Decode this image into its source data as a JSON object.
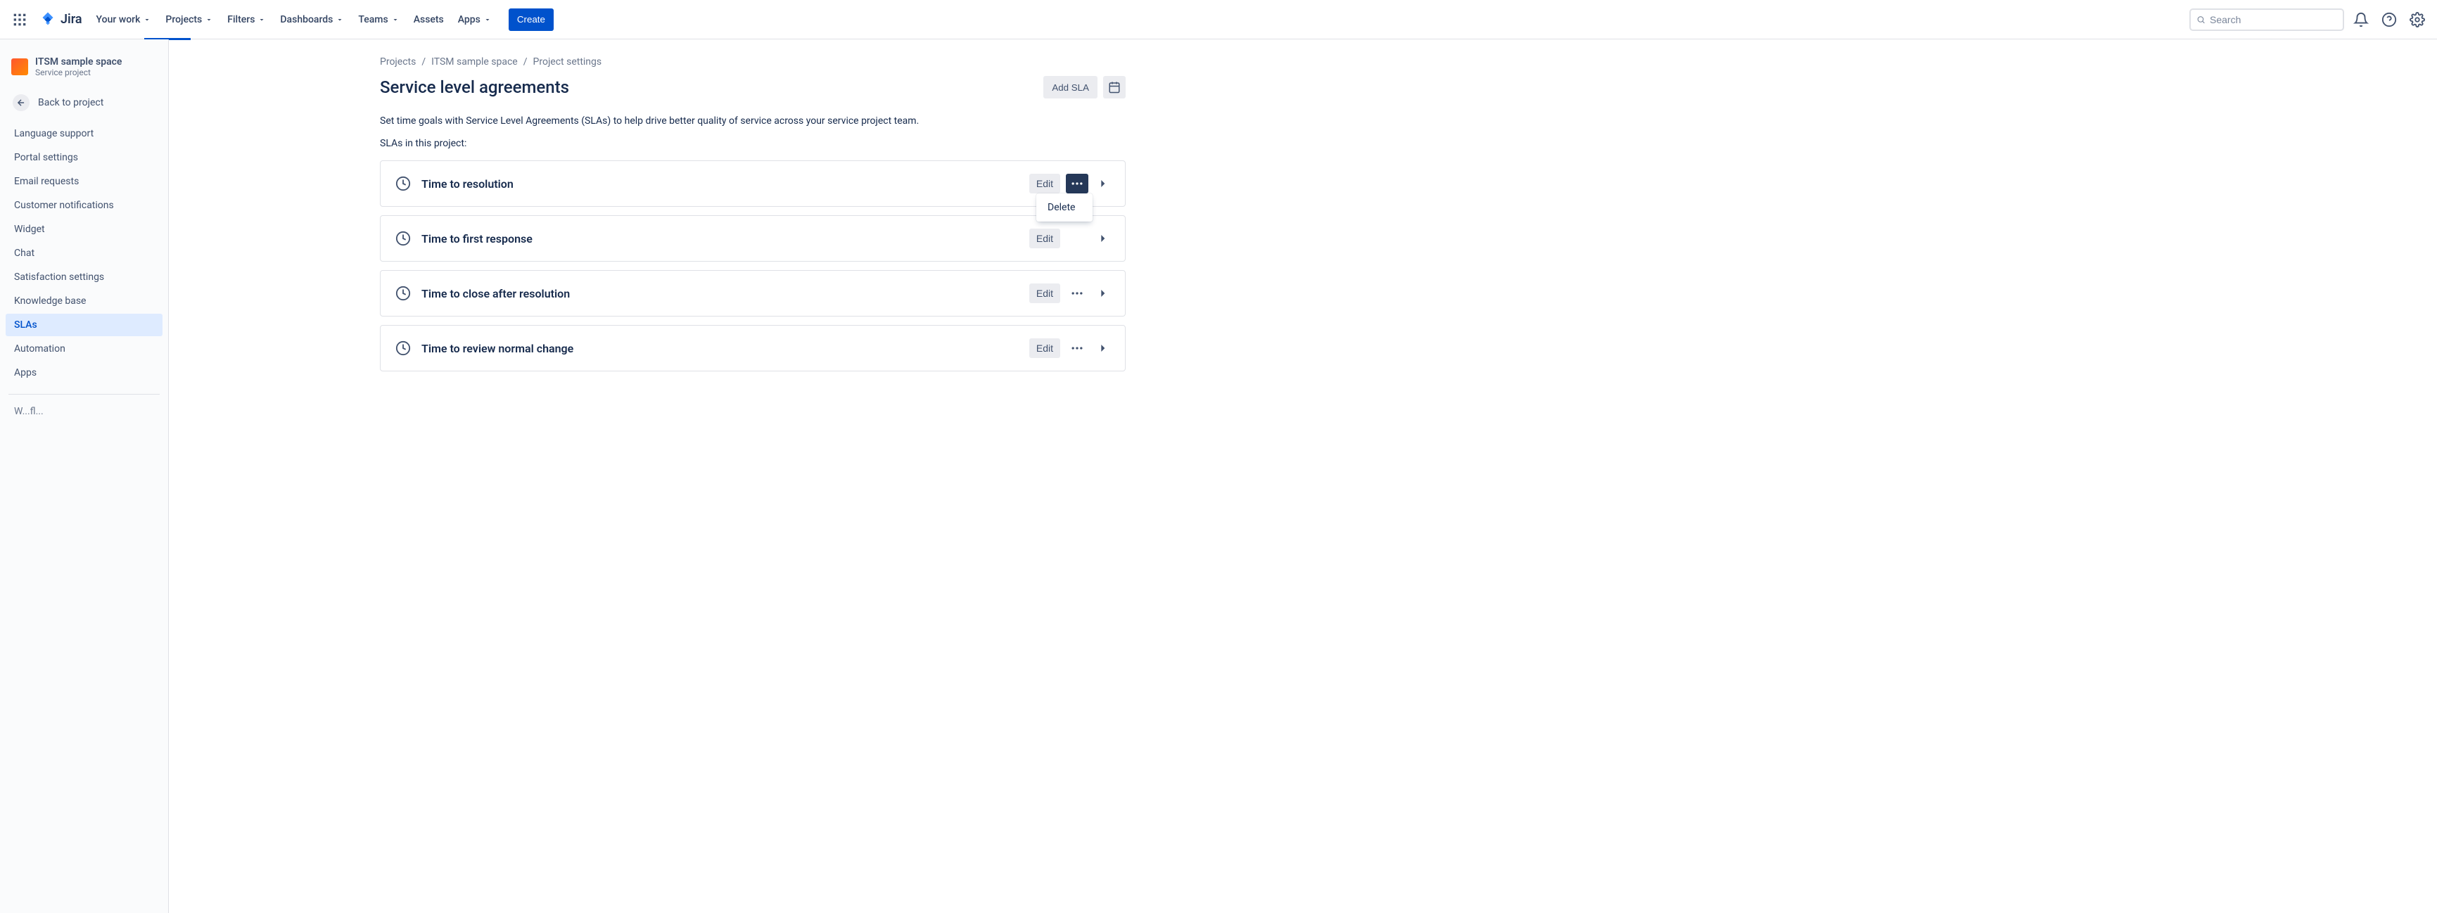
{
  "brand": {
    "name": "Jira"
  },
  "topnav": {
    "items": [
      {
        "label": "Your work"
      },
      {
        "label": "Projects"
      },
      {
        "label": "Filters"
      },
      {
        "label": "Dashboards"
      },
      {
        "label": "Teams"
      },
      {
        "label": "Assets"
      },
      {
        "label": "Apps"
      }
    ],
    "create_label": "Create",
    "search_placeholder": "Search"
  },
  "sidebar": {
    "project_name": "ITSM sample space",
    "project_sub": "Service project",
    "back_label": "Back to project",
    "items": [
      {
        "label": "Language support"
      },
      {
        "label": "Portal settings"
      },
      {
        "label": "Email requests"
      },
      {
        "label": "Customer notifications"
      },
      {
        "label": "Widget"
      },
      {
        "label": "Chat"
      },
      {
        "label": "Satisfaction settings"
      },
      {
        "label": "Knowledge base"
      },
      {
        "label": "SLAs"
      },
      {
        "label": "Automation"
      },
      {
        "label": "Apps"
      }
    ],
    "truncated_hint": "W...fl..."
  },
  "breadcrumb": {
    "items": [
      {
        "label": "Projects"
      },
      {
        "label": "ITSM sample space"
      },
      {
        "label": "Project settings"
      }
    ]
  },
  "page": {
    "title": "Service level agreements",
    "add_sla_label": "Add SLA",
    "description": "Set time goals with Service Level Agreements (SLAs) to help drive better quality of service across your service project team.",
    "subhead": "SLAs in this project:"
  },
  "slas": [
    {
      "title": "Time to resolution",
      "edit_label": "Edit"
    },
    {
      "title": "Time to first response",
      "edit_label": "Edit"
    },
    {
      "title": "Time to close after resolution",
      "edit_label": "Edit"
    },
    {
      "title": "Time to review normal change",
      "edit_label": "Edit"
    }
  ],
  "dropdown": {
    "delete_label": "Delete"
  }
}
